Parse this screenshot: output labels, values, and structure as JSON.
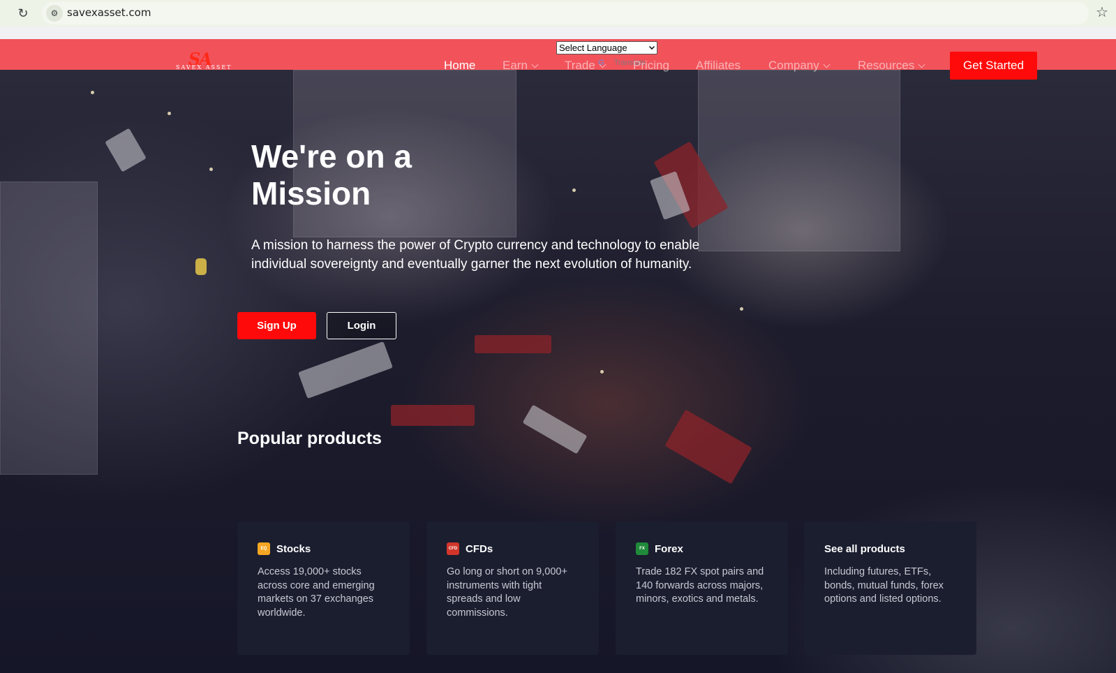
{
  "browser": {
    "url": "savexasset.com"
  },
  "brand": {
    "logo_mark": "SA",
    "logo_word": "SAVEX ASSET",
    "accent_color": "#ff0a0a",
    "nav_bg_color": "#f2535b"
  },
  "translate": {
    "select_label": "Select Language",
    "powered_text": "Translate"
  },
  "nav": {
    "items": [
      {
        "label": "Home",
        "has_dropdown": false,
        "active": true
      },
      {
        "label": "Earn",
        "has_dropdown": true,
        "active": false
      },
      {
        "label": "Trade",
        "has_dropdown": true,
        "active": false
      },
      {
        "label": "Pricing",
        "has_dropdown": false,
        "active": false
      },
      {
        "label": "Affiliates",
        "has_dropdown": false,
        "active": false
      },
      {
        "label": "Company",
        "has_dropdown": true,
        "active": false
      },
      {
        "label": "Resources",
        "has_dropdown": true,
        "active": false
      }
    ],
    "cta_label": "Get Started"
  },
  "hero": {
    "title": "We're on a Mission",
    "description": "A mission to harness the power of Crypto currency and technology to enable individual sovereignty and eventually garner the next evolution of humanity.",
    "signup_label": "Sign Up",
    "login_label": "Login"
  },
  "products": {
    "section_title": "Popular products",
    "cards": [
      {
        "badge": "EQ",
        "badge_color": "#f5a623",
        "title": "Stocks",
        "description": "Access 19,000+ stocks across core and emerging markets on 37 exchanges worldwide."
      },
      {
        "badge": "CFD",
        "badge_color": "#d2362b",
        "title": "CFDs",
        "description": "Go long or short on 9,000+ instruments with tight spreads and low commissions."
      },
      {
        "badge": "FX",
        "badge_color": "#1f8a3a",
        "title": "Forex",
        "description": "Trade 182 FX spot pairs and 140 forwards across majors, minors, exotics and metals."
      },
      {
        "badge": "",
        "badge_color": "",
        "title": "See all products",
        "description": "Including futures, ETFs, bonds, mutual funds, forex options and listed options."
      }
    ]
  }
}
